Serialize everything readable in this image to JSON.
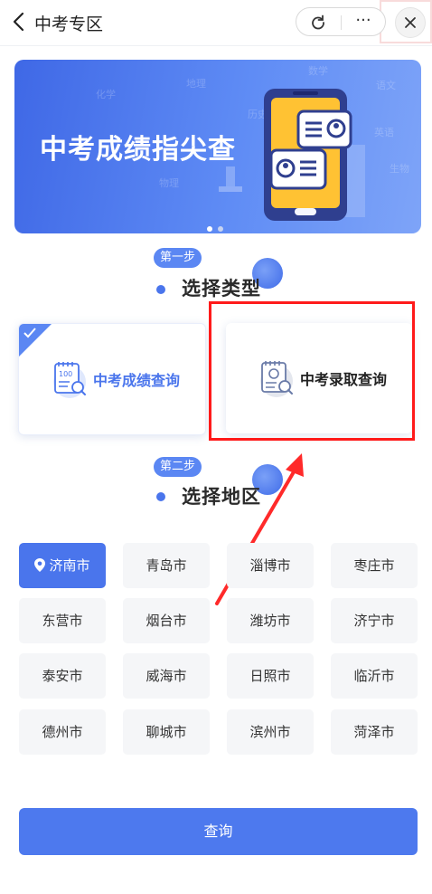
{
  "header": {
    "title": "中考专区",
    "more_label": "···"
  },
  "banner": {
    "title": "中考成绩指尖查",
    "decor_words": [
      "化学",
      "数学",
      "历史",
      "语文",
      "英语",
      "物理",
      "生物",
      "地理"
    ],
    "active_slide": 1,
    "slide_count": 2
  },
  "step1": {
    "badge": "第一步",
    "title": "选择类型"
  },
  "types": [
    {
      "label": "中考成绩查询",
      "selected": true,
      "icon": "report-card-icon",
      "icon_text": "100"
    },
    {
      "label": "中考录取查询",
      "selected": false,
      "icon": "admission-doc-icon"
    }
  ],
  "step2": {
    "badge": "第二步",
    "title": "选择地区"
  },
  "cities": [
    {
      "name": "济南市",
      "active": true
    },
    {
      "name": "青岛市",
      "active": false
    },
    {
      "name": "淄博市",
      "active": false
    },
    {
      "name": "枣庄市",
      "active": false
    },
    {
      "name": "东营市",
      "active": false
    },
    {
      "name": "烟台市",
      "active": false
    },
    {
      "name": "潍坊市",
      "active": false
    },
    {
      "name": "济宁市",
      "active": false
    },
    {
      "name": "泰安市",
      "active": false
    },
    {
      "name": "威海市",
      "active": false
    },
    {
      "name": "日照市",
      "active": false
    },
    {
      "name": "临沂市",
      "active": false
    },
    {
      "name": "德州市",
      "active": false
    },
    {
      "name": "聊城市",
      "active": false
    },
    {
      "name": "滨州市",
      "active": false
    },
    {
      "name": "菏泽市",
      "active": false
    }
  ],
  "submit_label": "查询",
  "colors": {
    "primary": "#4a75ec",
    "highlight": "#ff1a1a"
  }
}
